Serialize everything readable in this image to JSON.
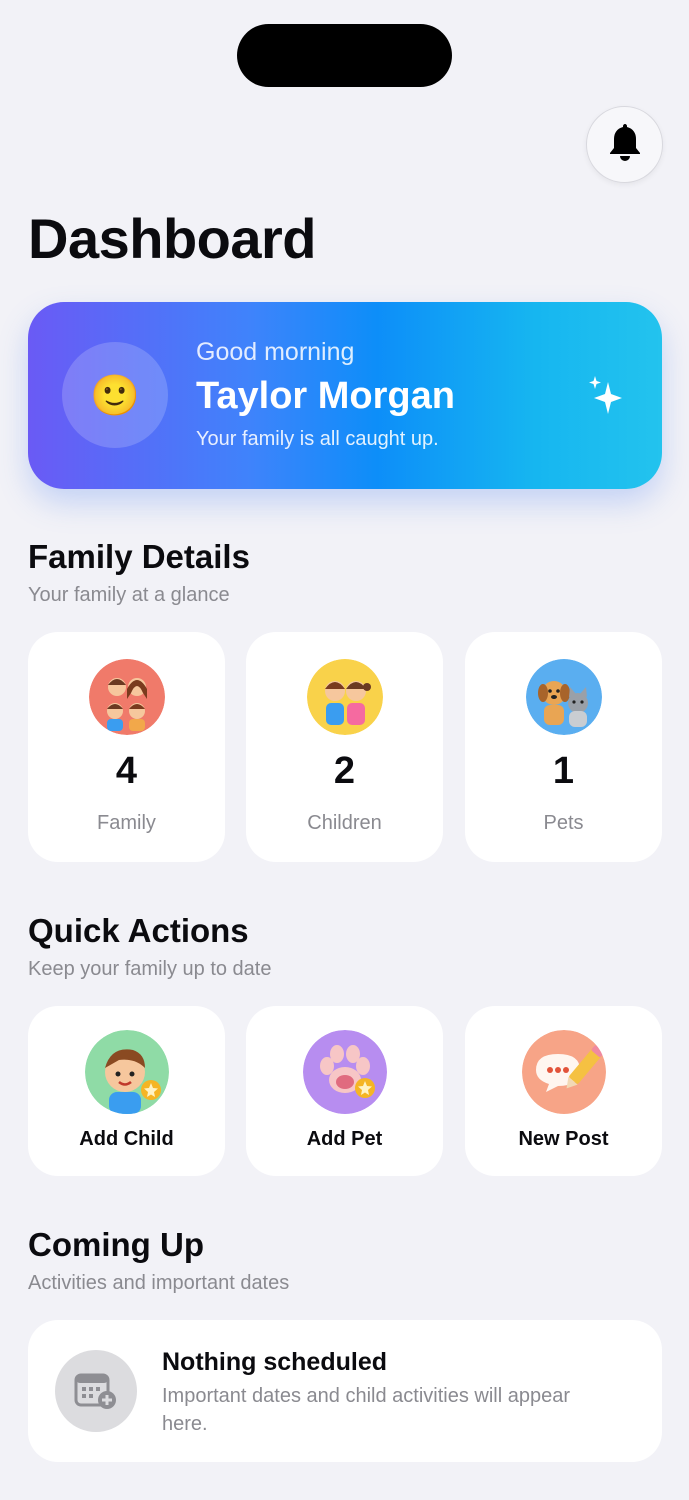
{
  "header": {
    "title": "Dashboard",
    "notification_icon": "bell-icon"
  },
  "greeting": {
    "salutation": "Good morning",
    "name": "Taylor Morgan",
    "message": "Your family is all caught up.",
    "avatar_emoji": "🙂",
    "accent_colors": [
      "#6a5af5",
      "#0d8ef9",
      "#23c3ee"
    ]
  },
  "family_details": {
    "title": "Family Details",
    "subtitle": "Your family at a glance",
    "stats": [
      {
        "value": "4",
        "label": "Family",
        "icon": "family-icon",
        "color": "#f07a6a"
      },
      {
        "value": "2",
        "label": "Children",
        "icon": "children-icon",
        "color": "#f9d24a"
      },
      {
        "value": "1",
        "label": "Pets",
        "icon": "pets-icon",
        "color": "#5aaef0"
      }
    ]
  },
  "quick_actions": {
    "title": "Quick Actions",
    "subtitle": "Keep your family up to date",
    "actions": [
      {
        "label": "Add Child",
        "icon": "add-child-icon",
        "color": "#8fdba6"
      },
      {
        "label": "Add Pet",
        "icon": "add-pet-icon",
        "color": "#b78df0"
      },
      {
        "label": "New Post",
        "icon": "new-post-icon",
        "color": "#f7a487"
      }
    ]
  },
  "coming_up": {
    "title": "Coming Up",
    "subtitle": "Activities and important dates",
    "empty_title": "Nothing scheduled",
    "empty_body": "Important dates and child activities will appear here.",
    "icon": "calendar-add-icon"
  }
}
